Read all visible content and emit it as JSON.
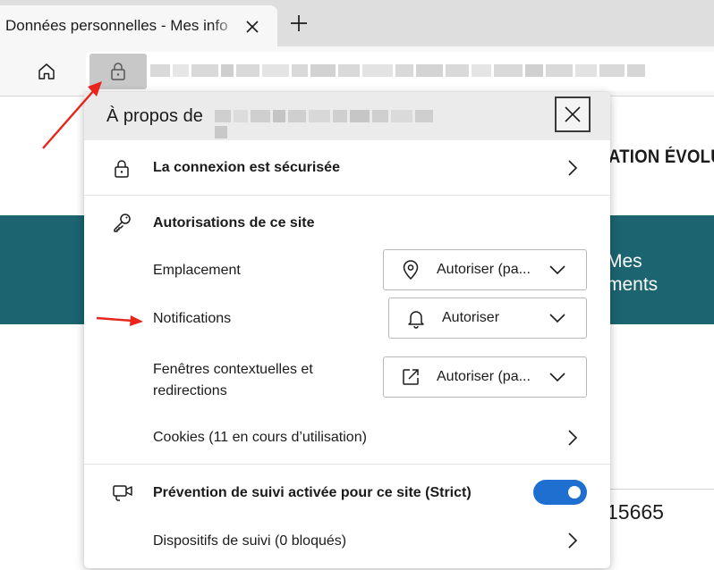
{
  "browser": {
    "tab_title": "Données personnelles - Mes info",
    "icons": {
      "close_tab": "close-icon",
      "new_tab": "plus-icon",
      "home": "home-icon",
      "site_info": "lock-icon"
    }
  },
  "page": {
    "header_text": "ATION ÉVOLUE",
    "banner_line1": "Mes",
    "banner_line2": "ments",
    "number": "15665",
    "colors": {
      "banner": "#1b6470"
    }
  },
  "popup": {
    "title": "À propos de",
    "close_icon": "close-icon",
    "connection": {
      "label": "La connexion est sécurisée",
      "icon": "lock-icon"
    },
    "permissions": {
      "heading": "Autorisations de ce site",
      "icon": "key-icon",
      "items": [
        {
          "label": "Emplacement",
          "value": "Autoriser (pa...",
          "icon": "location-pin-icon"
        },
        {
          "label": "Notifications",
          "value": "Autoriser",
          "icon": "bell-icon"
        },
        {
          "label_line1": "Fenêtres contextuelles et",
          "label_line2": "redirections",
          "value": "Autoriser (pa...",
          "icon": "external-link-icon"
        }
      ]
    },
    "cookies": {
      "label": "Cookies (11 en cours d’utilisation)"
    },
    "tracking": {
      "label": "Prévention de suivi activée pour ce site (Strict)",
      "toggle_on": true,
      "icon": "tracking-camera-icon",
      "trackers_label": "Dispositifs de suivi (0 bloqués)"
    },
    "colors": {
      "toggle": "#1f6fd0",
      "header": "#ebebeb"
    }
  },
  "annotations": {
    "arrow_color": "#e8241c"
  }
}
